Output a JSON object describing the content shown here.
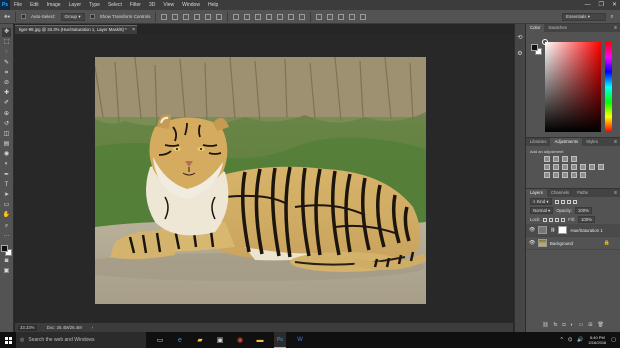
{
  "app": {
    "logo": "Ps"
  },
  "menubar": {
    "items": [
      "File",
      "Edit",
      "Image",
      "Layer",
      "Type",
      "Select",
      "Filter",
      "3D",
      "View",
      "Window",
      "Help"
    ],
    "window_controls": [
      "—",
      "❐",
      "✕"
    ]
  },
  "options": {
    "auto_select_label": "Auto-Select:",
    "auto_select_value": "Group",
    "transform_label": "Show Transform Controls",
    "workspace": "Essentials"
  },
  "document": {
    "tab_title": "tiger-98.jpg @ 33.3% (Hue/Saturation 1, Layer Mask/8) *",
    "tab_close": "×",
    "status_zoom": "33.33%",
    "status_doc": "Doc: 26.4M/26.4M"
  },
  "tools": [
    "move-tool",
    "marquee-tool",
    "lasso-tool",
    "quick-select-tool",
    "crop-tool",
    "eyedropper-tool",
    "healing-brush-tool",
    "brush-tool",
    "clone-stamp-tool",
    "history-brush-tool",
    "eraser-tool",
    "gradient-tool",
    "blur-tool",
    "dodge-tool",
    "pen-tool",
    "type-tool",
    "path-select-tool",
    "shape-tool",
    "hand-tool",
    "zoom-tool",
    "more-tools"
  ],
  "tool_glyphs": [
    "✥",
    "⬚",
    "◌",
    "✎",
    "⌗",
    "⊘",
    "✚",
    "✐",
    "⊕",
    "↺",
    "◫",
    "▤",
    "◉",
    "◐",
    "✒",
    "T",
    "➤",
    "▭",
    "✋",
    "⌕",
    "···"
  ],
  "color_panel": {
    "tabs": [
      "Color",
      "Swatches"
    ]
  },
  "adjustments_panel": {
    "tabs": [
      "Libraries",
      "Adjustments",
      "Styles"
    ],
    "add_label": "Add an adjustment"
  },
  "layers_panel": {
    "tabs": [
      "Layers",
      "Channels",
      "Paths"
    ],
    "filter_label": "Kind",
    "blend_mode": "Normal",
    "opacity_label": "Opacity:",
    "opacity_value": "100%",
    "lock_label": "Lock:",
    "fill_label": "Fill:",
    "fill_value": "100%",
    "layers": [
      {
        "name": "Hue/Saturation 1",
        "visible": true
      },
      {
        "name": "Background",
        "visible": true
      }
    ]
  },
  "taskbar": {
    "search_placeholder": "Search the web and Windows",
    "time": "5:40 PM",
    "date": "2/16/2016"
  },
  "colors": {
    "ui_dark": "#262626",
    "panel": "#535353",
    "accent": "#31a8ff"
  }
}
